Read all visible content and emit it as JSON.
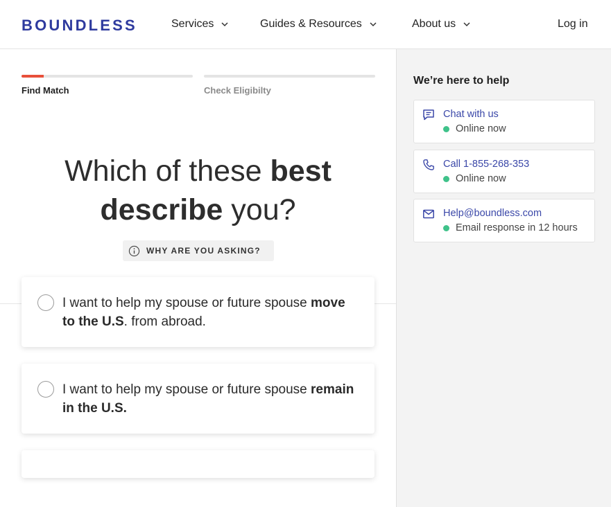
{
  "header": {
    "logo": "BOUNDLESS",
    "nav": [
      {
        "label": "Services"
      },
      {
        "label": "Guides & Resources"
      },
      {
        "label": "About us"
      }
    ],
    "login": "Log in"
  },
  "progress": {
    "steps": [
      {
        "label": "Find Match",
        "fill_percent": 13
      },
      {
        "label": "Check Eligibilty",
        "fill_percent": 0
      }
    ]
  },
  "question": {
    "line1_plain": "Which of these ",
    "line1_bold": "best",
    "line2_bold": "describe",
    "line2_plain": " you?"
  },
  "why_button": {
    "label": "WHY ARE YOU ASKING?",
    "icon": "info-icon"
  },
  "options": [
    {
      "text_plain": "I want to help my spouse or future spouse ",
      "text_bold": "move to the U.S",
      "text_after": ". from abroad."
    },
    {
      "text_plain": "I want to help my spouse or future spouse ",
      "text_bold": "remain in the U.S.",
      "text_after": ""
    }
  ],
  "help": {
    "title": "We’re here to help",
    "cards": [
      {
        "title": "Chat with us",
        "status": "Online now",
        "icon": "chat-icon"
      },
      {
        "title": "Call 1-855-268-353",
        "status": "Online now",
        "icon": "phone-icon"
      },
      {
        "title": "Help@boundless.com",
        "status": "Email response in 12 hours",
        "icon": "mail-icon"
      }
    ]
  },
  "colors": {
    "brand": "#2e3a9e",
    "link": "#3a47a8",
    "progress_accent": "#e8503a",
    "online_dot": "#3fc28a"
  }
}
